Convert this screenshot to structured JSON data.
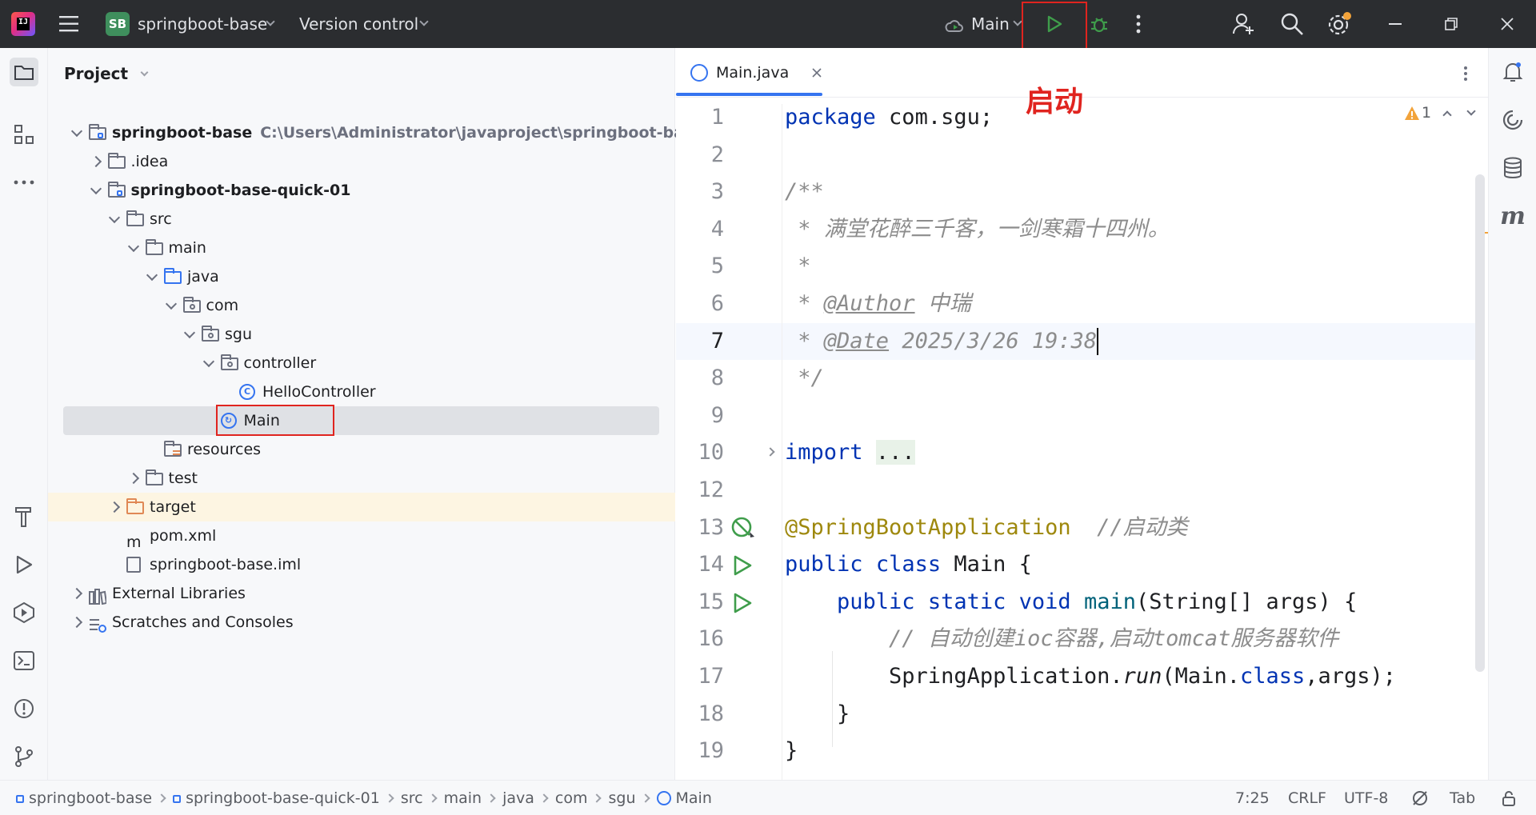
{
  "titlebar": {
    "project_badge": "SB",
    "project_name": "springboot-base",
    "vcs_label": "Version control",
    "run_config": "Main",
    "annotation": "启动"
  },
  "project_panel": {
    "title": "Project",
    "tree": [
      {
        "label": "springboot-base",
        "path": "C:\\Users\\Administrator\\javaproject\\springboot-base",
        "depth": 0,
        "expander": "down",
        "icon": "module-folder-icon",
        "bold": true
      },
      {
        "label": ".idea",
        "depth": 1,
        "expander": "right",
        "icon": "folder-icon"
      },
      {
        "label": "springboot-base-quick-01",
        "depth": 1,
        "expander": "down",
        "icon": "module-folder-icon",
        "bold": true
      },
      {
        "label": "src",
        "depth": 2,
        "expander": "down",
        "icon": "folder-icon"
      },
      {
        "label": "main",
        "depth": 3,
        "expander": "down",
        "icon": "folder-icon"
      },
      {
        "label": "java",
        "depth": 4,
        "expander": "down",
        "icon": "source-folder-icon"
      },
      {
        "label": "com",
        "depth": 5,
        "expander": "down",
        "icon": "package-icon"
      },
      {
        "label": "sgu",
        "depth": 6,
        "expander": "down",
        "icon": "package-icon"
      },
      {
        "label": "controller",
        "depth": 7,
        "expander": "down",
        "icon": "package-icon"
      },
      {
        "label": "HelloController",
        "depth": 8,
        "expander": "none",
        "icon": "class-icon"
      },
      {
        "label": "Main",
        "depth": 7,
        "expander": "none",
        "icon": "spring-class-icon",
        "selected": true
      },
      {
        "label": "resources",
        "depth": 4,
        "expander": "none",
        "icon": "resources-folder-icon"
      },
      {
        "label": "test",
        "depth": 3,
        "expander": "right",
        "icon": "folder-icon"
      },
      {
        "label": "target",
        "depth": 2,
        "expander": "right",
        "icon": "excluded-folder-icon",
        "highlight": true
      },
      {
        "label": "pom.xml",
        "depth": 2,
        "expander": "none",
        "icon": "maven-icon"
      },
      {
        "label": "springboot-base.iml",
        "depth": 2,
        "expander": "none",
        "icon": "file-icon"
      },
      {
        "label": "External Libraries",
        "depth": 0,
        "expander": "right",
        "icon": "libraries-icon"
      },
      {
        "label": "Scratches and Consoles",
        "depth": 0,
        "expander": "right",
        "icon": "scratches-icon"
      }
    ]
  },
  "editor": {
    "tab_label": "Main.java",
    "warnings_count": "1",
    "lines": [
      {
        "num": "1",
        "segs": [
          {
            "t": "package",
            "c": "kw"
          },
          {
            "t": " com.sgu;",
            "c": ""
          }
        ]
      },
      {
        "num": "2",
        "segs": []
      },
      {
        "num": "3",
        "segs": [
          {
            "t": "/**",
            "c": "cm"
          }
        ]
      },
      {
        "num": "4",
        "segs": [
          {
            "t": " * 满堂花醉三千客，一剑寒霜十四州。",
            "c": "cm"
          }
        ]
      },
      {
        "num": "5",
        "segs": [
          {
            "t": " *",
            "c": "cm"
          }
        ]
      },
      {
        "num": "6",
        "segs": [
          {
            "t": " * ",
            "c": "cm"
          },
          {
            "t": "@Author",
            "c": "tag"
          },
          {
            "t": " 中瑞",
            "c": "cm"
          }
        ]
      },
      {
        "num": "7",
        "segs": [
          {
            "t": " * ",
            "c": "cm"
          },
          {
            "t": "@Date",
            "c": "tag"
          },
          {
            "t": " 2025/3/26 19:38",
            "c": "cm"
          }
        ],
        "current": true
      },
      {
        "num": "8",
        "segs": [
          {
            "t": " */",
            "c": "cm"
          }
        ]
      },
      {
        "num": "9",
        "segs": []
      },
      {
        "num": "10",
        "segs": [
          {
            "t": "import",
            "c": "kw"
          },
          {
            "t": " ",
            "c": ""
          },
          {
            "t": "...",
            "c": "fold-bg"
          }
        ],
        "fold": true
      },
      {
        "num": "12",
        "segs": []
      },
      {
        "num": "13",
        "segs": [
          {
            "t": "@SpringBootApplication",
            "c": "ann"
          },
          {
            "t": "  //启动类",
            "c": "cm"
          }
        ],
        "gutter": "spring-bean-icon"
      },
      {
        "num": "14",
        "segs": [
          {
            "t": "public",
            "c": "kw"
          },
          {
            "t": " ",
            "c": ""
          },
          {
            "t": "class",
            "c": "kw"
          },
          {
            "t": " Main {",
            "c": ""
          }
        ],
        "gutter": "run-gutter-icon"
      },
      {
        "num": "15",
        "segs": [
          {
            "t": "    ",
            "c": ""
          },
          {
            "t": "public",
            "c": "kw"
          },
          {
            "t": " ",
            "c": ""
          },
          {
            "t": "static",
            "c": "kw"
          },
          {
            "t": " ",
            "c": ""
          },
          {
            "t": "void",
            "c": "kw"
          },
          {
            "t": " ",
            "c": ""
          },
          {
            "t": "main",
            "c": "fn"
          },
          {
            "t": "(String[] args) {",
            "c": ""
          }
        ],
        "gutter": "run-gutter-icon"
      },
      {
        "num": "16",
        "segs": [
          {
            "t": "        ",
            "c": ""
          },
          {
            "t": "// 自动创建ioc容器,启动tomcat服务器软件",
            "c": "cm"
          }
        ]
      },
      {
        "num": "17",
        "segs": [
          {
            "t": "        SpringApplication.",
            "c": ""
          },
          {
            "t": "run",
            "c": "it"
          },
          {
            "t": "(Main.",
            "c": ""
          },
          {
            "t": "class",
            "c": "kw"
          },
          {
            "t": ",args);",
            "c": ""
          }
        ]
      },
      {
        "num": "18",
        "segs": [
          {
            "t": "    }",
            "c": ""
          }
        ]
      },
      {
        "num": "19",
        "segs": [
          {
            "t": "}",
            "c": ""
          }
        ]
      }
    ]
  },
  "statusbar": {
    "breadcrumbs": [
      "springboot-base",
      "springboot-base-quick-01",
      "src",
      "main",
      "java",
      "com",
      "sgu",
      "Main"
    ],
    "caret_pos": "7:25",
    "line_sep": "CRLF",
    "encoding": "UTF-8",
    "indent": "Tab"
  },
  "colors": {
    "accent": "#3574f0",
    "run_green": "#3f9d4b",
    "annotation_red": "#e0241f",
    "titlebar_bg": "#2b2d30"
  }
}
